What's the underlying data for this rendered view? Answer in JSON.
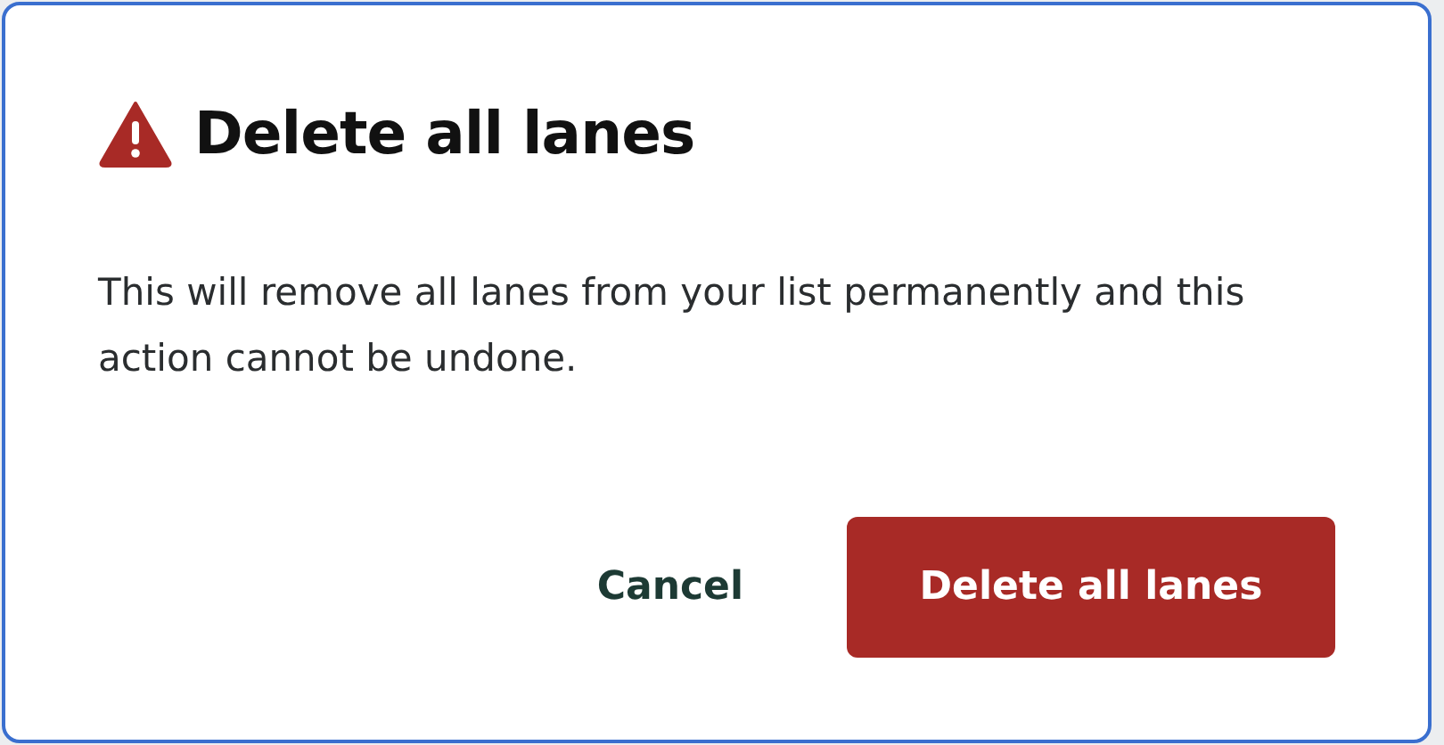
{
  "dialog": {
    "title": "Delete all lanes",
    "message": "This will remove all lanes from your list permanently and this action cannot be undone.",
    "buttons": [
      {
        "label": "Cancel",
        "kind": "text"
      },
      {
        "label": "Delete all lanes",
        "kind": "danger"
      }
    ]
  }
}
